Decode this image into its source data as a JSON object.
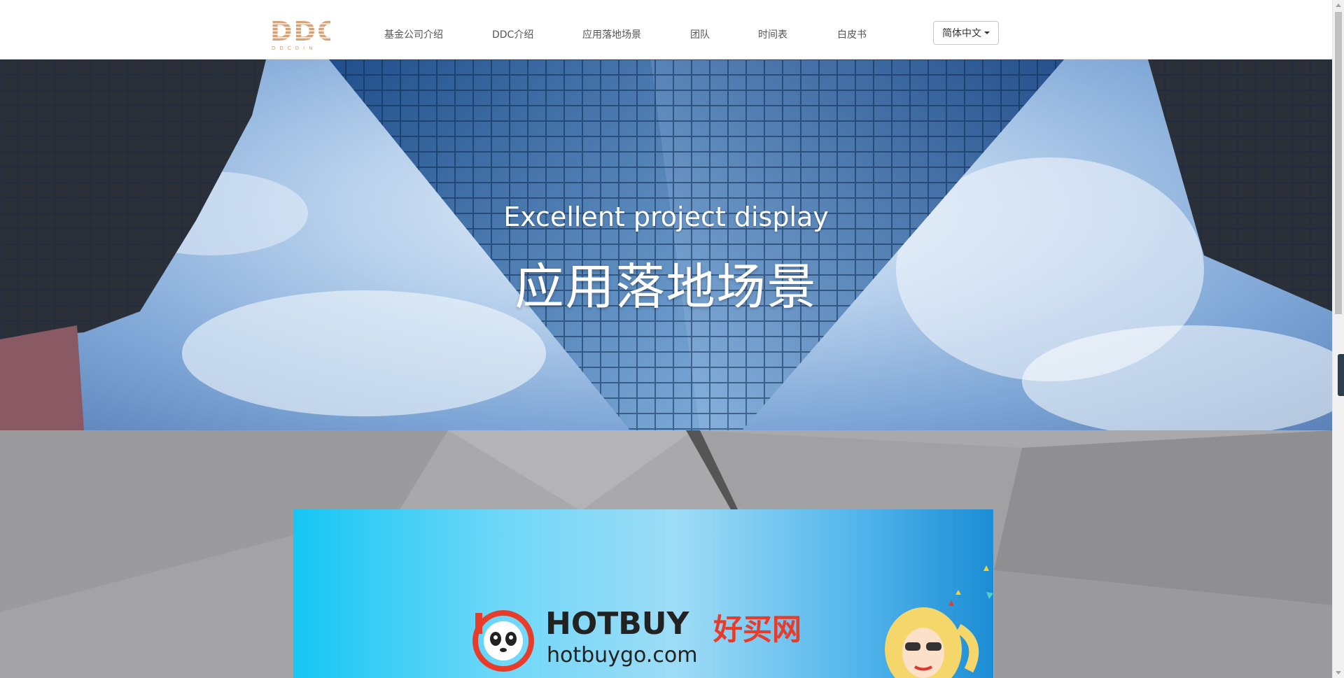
{
  "header": {
    "logo": {
      "text": "DDC",
      "sub": "DDCOIN"
    },
    "nav": [
      {
        "label": "基金公司介绍"
      },
      {
        "label": "DDC介绍"
      },
      {
        "label": "应用落地场景"
      },
      {
        "label": "团队"
      },
      {
        "label": "时间表"
      },
      {
        "label": "白皮书"
      }
    ],
    "language": {
      "selected": "简体中文"
    }
  },
  "hero": {
    "subtitle": "Excellent project display",
    "title": "应用落地场景"
  },
  "banner": {
    "brand_en": "HOTBUY",
    "brand_cn": "好买网",
    "url": "hotbuygo.com"
  },
  "colors": {
    "nav_text": "#555555",
    "hero_text": "#ffffff",
    "section_bg": "#a9a9ab",
    "banner_blue": "#14c7f4",
    "brand_red": "#e83c2a"
  }
}
